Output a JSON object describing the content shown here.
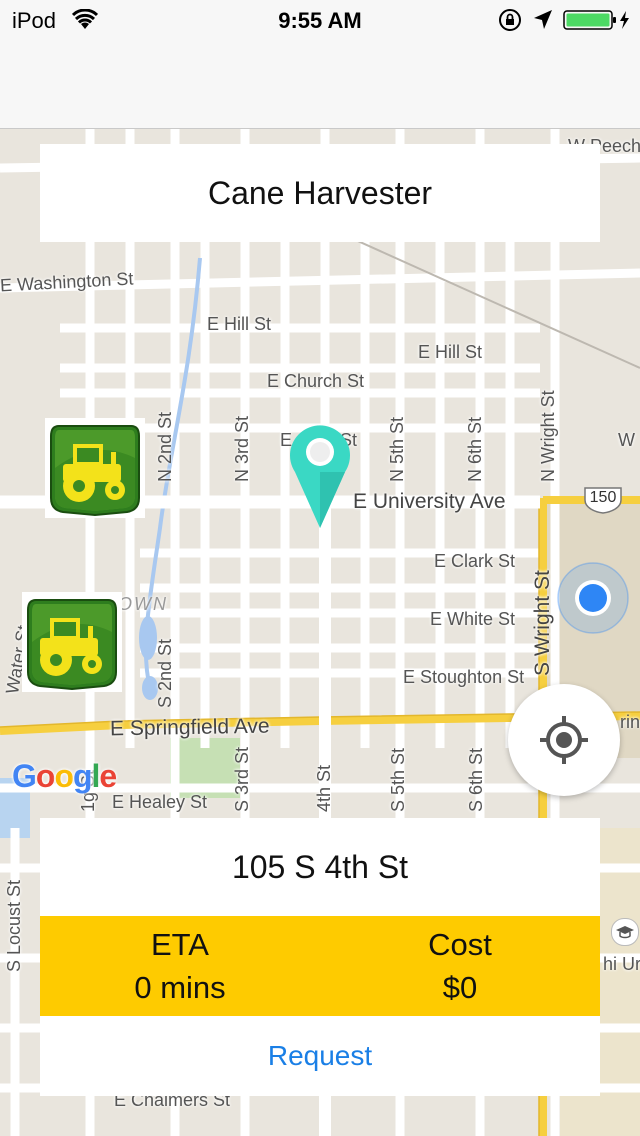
{
  "status_bar": {
    "carrier": "iPod",
    "time": "9:55 AM"
  },
  "header": {
    "title": "Cane Harvester"
  },
  "map": {
    "streets": {
      "e_washington": "E Washington St",
      "e_hill_1": "E Hill St",
      "e_hill_2": "E Hill St",
      "e_church": "E Church St",
      "e_main_partial": "E",
      "e_main_st": "St",
      "e_university": "E University Ave",
      "e_clark": "E Clark St",
      "e_white": "E White St",
      "e_stoughton": "E Stoughton St",
      "e_springfield": "E Springfield Ave",
      "e_healey": "E Healey St",
      "e_chalmers": "E Chalmers St",
      "n_2nd": "N 2nd St",
      "n_3rd": "N 3rd St",
      "n_5th": "N 5th St",
      "n_6th": "N 6th St",
      "n_wright": "N Wright St",
      "s_2nd": "S 2nd St",
      "s_3rd": "S 3rd St",
      "s_4th": "4th St",
      "s_5th": "S 5th St",
      "s_6th": "S 6th St",
      "s_wright": "S Wright St",
      "s_locust": "S Locust St",
      "water_st": "Water St",
      "lg_st": "1g St",
      "downtown_partial": "OWN",
      "w_partial": "W",
      "w_peech": "W Peech",
      "rin_partial": "rin",
      "hi_ur_partial": "hi Ur",
      "route": "150"
    },
    "google_letters": [
      "G",
      "o",
      "o",
      "g",
      "l",
      "e"
    ],
    "google_colors": [
      "#4285f4",
      "#ea4335",
      "#fbbc05",
      "#4285f4",
      "#34a853",
      "#ea4335"
    ]
  },
  "info": {
    "address": "105 S 4th St",
    "eta_label": "ETA",
    "eta_value": "0 mins",
    "cost_label": "Cost",
    "cost_value": "$0",
    "request_label": "Request"
  },
  "colors": {
    "accent_yellow": "#fecb00",
    "link_blue": "#1a7fe6",
    "pin_teal": "#3ad8c4",
    "user_dot": "#2e86f5"
  },
  "icons": {
    "wifi": "wifi-icon",
    "rotation_lock": "rotation-lock-icon",
    "location_arrow": "location-arrow-icon",
    "battery": "battery-charging-icon",
    "tractor": "tractor-icon",
    "pin": "map-pin-icon",
    "my_location": "my-location-icon",
    "graduation_cap": "graduation-cap-icon"
  }
}
